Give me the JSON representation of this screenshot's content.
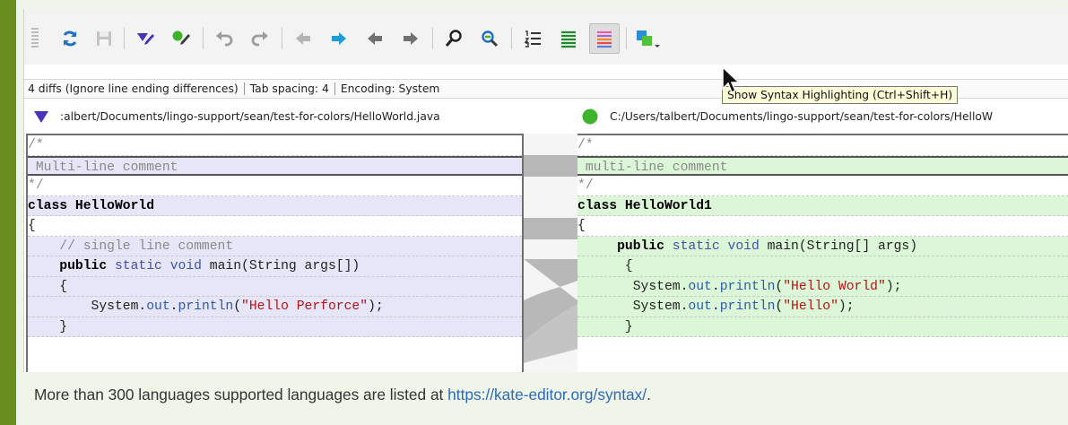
{
  "status": {
    "diffs": "4 diffs (Ignore line ending differences)",
    "tab_spacing": "Tab spacing: 4",
    "encoding": "Encoding: System"
  },
  "tooltip": "Show Syntax Highlighting (Ctrl+Shift+H)",
  "files": {
    "left_path": ":albert/Documents/lingo-support/sean/test-for-colors/HelloWorld.java",
    "right_path": "C:/Users/talbert/Documents/lingo-support/sean/test-for-colors/HelloW",
    "left_marker_color": "#4a33b8",
    "right_marker_color": "#3fb32a"
  },
  "toolbar_icons": [
    "refresh-icon",
    "save-icon",
    "diamond-marker-icon",
    "circle-marker-icon",
    "undo-icon",
    "redo-icon",
    "previous-file-icon",
    "next-diff-icon",
    "previous-diff-icon",
    "next-file-icon",
    "find-icon",
    "find-next-icon",
    "line-numbers-icon",
    "diff-lines-icon",
    "syntax-highlighting-icon",
    "merge-options-icon"
  ],
  "left": {
    "rows": [
      {
        "kind": "ctx",
        "text": "/*"
      },
      {
        "kind": "L",
        "text": " Multi-line comment"
      },
      {
        "kind": "ctx",
        "text": "*/"
      },
      {
        "kind": "L",
        "text": "class HelloWorld"
      },
      {
        "kind": "ctx",
        "text": "{"
      },
      {
        "kind": "L",
        "text": "    // single line comment"
      },
      {
        "kind": "L",
        "text": "    public static void main(String args[])"
      },
      {
        "kind": "L",
        "text": "    {"
      },
      {
        "kind": "L",
        "text": "        System.out.println(\"Hello Perforce\");"
      },
      {
        "kind": "L",
        "text": "    }"
      }
    ]
  },
  "right": {
    "rows": [
      {
        "kind": "ctx",
        "text": "/*"
      },
      {
        "kind": "R",
        "text": " multi-line comment"
      },
      {
        "kind": "ctx",
        "text": "*/"
      },
      {
        "kind": "R",
        "text": "class HelloWorld1"
      },
      {
        "kind": "ctx",
        "text": "{"
      },
      {
        "kind": "R",
        "text": "     public static void main(String[] args)"
      },
      {
        "kind": "R",
        "text": "      {"
      },
      {
        "kind": "R",
        "text": "       System.out.println(\"Hello World\");"
      },
      {
        "kind": "R",
        "text": "       System.out.println(\"Hello\");"
      },
      {
        "kind": "R",
        "text": "      }"
      }
    ]
  },
  "caption": {
    "text": "More than 300 languages supported languages are listed at ",
    "link": "https://kate-editor.org/syntax/",
    "end": "."
  }
}
